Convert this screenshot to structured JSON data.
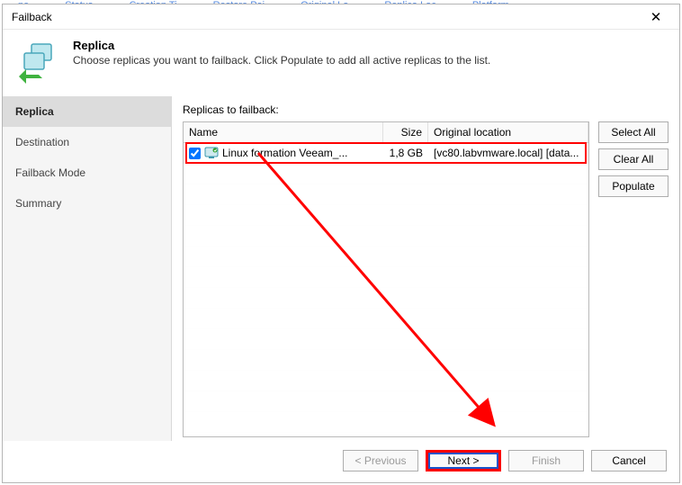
{
  "bg_tabs": [
    "ne",
    "Status",
    "Creation Ti",
    "Restore Poi",
    "Original Lo",
    "Replica Loc",
    "Platform"
  ],
  "window": {
    "title": "Failback"
  },
  "header": {
    "title": "Replica",
    "subtitle": "Choose replicas you want to failback. Click Populate to add all active replicas to the list."
  },
  "sidebar": {
    "items": [
      {
        "label": "Replica",
        "active": true
      },
      {
        "label": "Destination",
        "active": false
      },
      {
        "label": "Failback Mode",
        "active": false
      },
      {
        "label": "Summary",
        "active": false
      }
    ]
  },
  "content": {
    "label": "Replicas to failback:",
    "columns": {
      "name": "Name",
      "size": "Size",
      "location": "Original location"
    },
    "rows": [
      {
        "checked": true,
        "name": "Linux formation Veeam_...",
        "size": "1,8 GB",
        "location": "[vc80.labvmware.local] [data..."
      }
    ],
    "side_buttons": {
      "select_all": "Select All",
      "clear_all": "Clear All",
      "populate": "Populate"
    }
  },
  "footer": {
    "previous": "< Previous",
    "next": "Next >",
    "finish": "Finish",
    "cancel": "Cancel"
  }
}
